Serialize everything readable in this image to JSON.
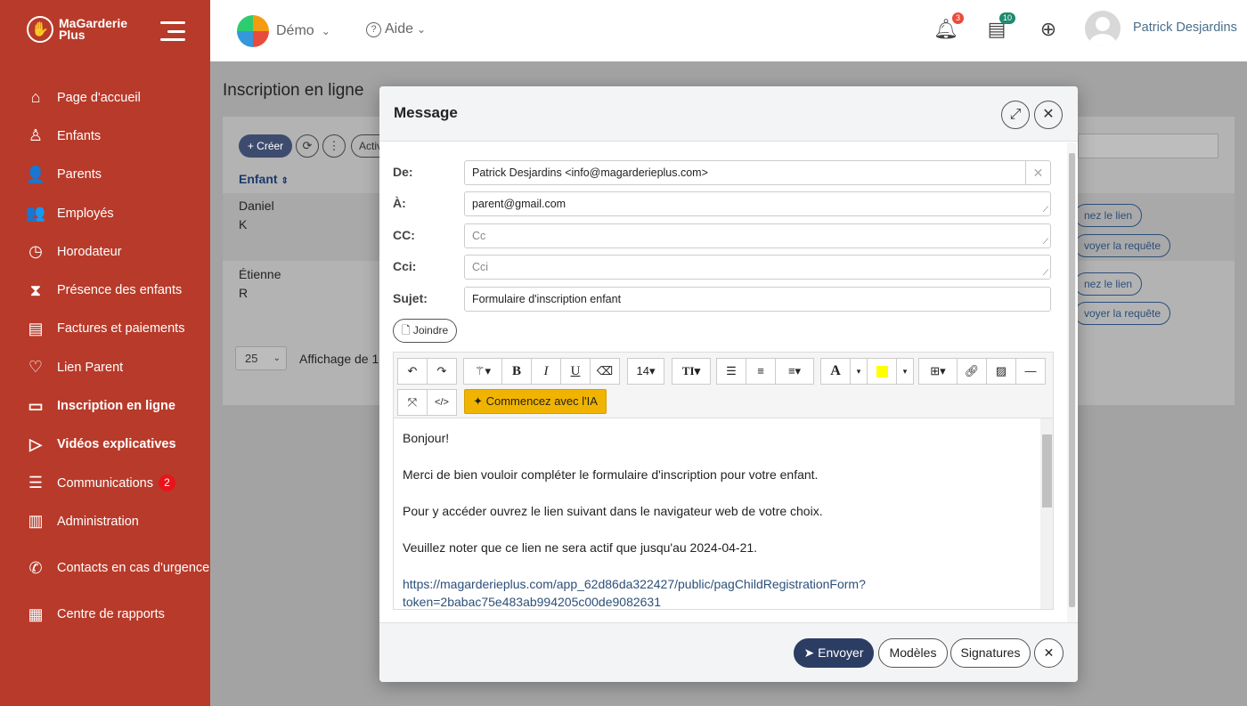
{
  "brand": {
    "logo_line1": "MaGarderie",
    "logo_line2": "Plus"
  },
  "sidebar": {
    "items": [
      {
        "label": "Page d'accueil",
        "icon": "home-icon",
        "glyph": "⌂"
      },
      {
        "label": "Enfants",
        "icon": "child-icon",
        "glyph": "♙"
      },
      {
        "label": "Parents",
        "icon": "parent-icon",
        "glyph": "👤"
      },
      {
        "label": "Employés",
        "icon": "employees-icon",
        "glyph": "👥"
      },
      {
        "label": "Horodateur",
        "icon": "clock-icon",
        "glyph": "◷"
      },
      {
        "label": "Présence des enfants",
        "icon": "hourglass-icon",
        "glyph": "⧗"
      },
      {
        "label": "Factures et paiements",
        "icon": "invoice-icon",
        "glyph": "▤"
      },
      {
        "label": "Lien Parent",
        "icon": "heart-icon",
        "glyph": "♡"
      },
      {
        "label": "Inscription en ligne",
        "icon": "id-card-icon",
        "glyph": "▭"
      },
      {
        "label": "Vidéos explicatives",
        "icon": "video-icon",
        "glyph": "▷"
      },
      {
        "label": "Communications",
        "icon": "chat-icon",
        "glyph": "☰",
        "badge": "2"
      },
      {
        "label": "Administration",
        "icon": "building-icon",
        "glyph": "▥"
      },
      {
        "label": "Contacts en cas d'urgence",
        "icon": "phone-icon",
        "glyph": "✆"
      },
      {
        "label": "Centre de rapports",
        "icon": "report-icon",
        "glyph": "▦"
      }
    ],
    "active_index": 8
  },
  "topbar": {
    "demo_label": "Démo",
    "help_label": "Aide",
    "notifications_count": "3",
    "messages_count": "10",
    "user_name": "Patrick Desjardins",
    "colors": {
      "notif_badge": "#e74c3c",
      "msg_badge": "#1e8a6e"
    }
  },
  "page": {
    "title": "Inscription en ligne",
    "create_label": "+ Créer",
    "activ_label": "Activ",
    "column_child": "Enfant",
    "rows": [
      {
        "first": "Daniel",
        "last": "K"
      },
      {
        "first": "Étienne",
        "last": "R"
      }
    ],
    "link_label": "nez le lien",
    "request_label": "voyer la requête",
    "page_size": "25",
    "showing_text": "Affichage de 1"
  },
  "modal": {
    "title": "Message",
    "from_label": "De:",
    "from_value": "Patrick Desjardins <info@magarderieplus.com>",
    "to_label": "À:",
    "to_value": "parent@gmail.com",
    "cc_label": "CC:",
    "cc_placeholder": "Cc",
    "bcc_label": "Cci:",
    "bcc_placeholder": "Cci",
    "subject_label": "Sujet:",
    "subject_value": "Formulaire d'inscription enfant",
    "attach_label": "Joindre",
    "toolbar": {
      "font_size": "14",
      "ai_label": "Commencez avec l'IA",
      "code_label": "</>"
    },
    "body": {
      "greeting": "Bonjour!",
      "line1": "Merci de bien vouloir compléter le formulaire d'inscription pour votre enfant.",
      "line2": "Pour y accéder ouvrez le lien suivant dans le navigateur web de votre choix.",
      "line3": "Veuillez noter que ce lien ne sera actif que jusqu'au 2024-04-21.",
      "link_line1": "https://magarderieplus.com/app_62d86da322427/public/pagChildRegistrationForm?",
      "link_line2": "token=2babac75e483ab994205c00de9082631"
    },
    "footer": {
      "send_label": "Envoyer",
      "templates_label": "Modèles",
      "signatures_label": "Signatures"
    }
  }
}
